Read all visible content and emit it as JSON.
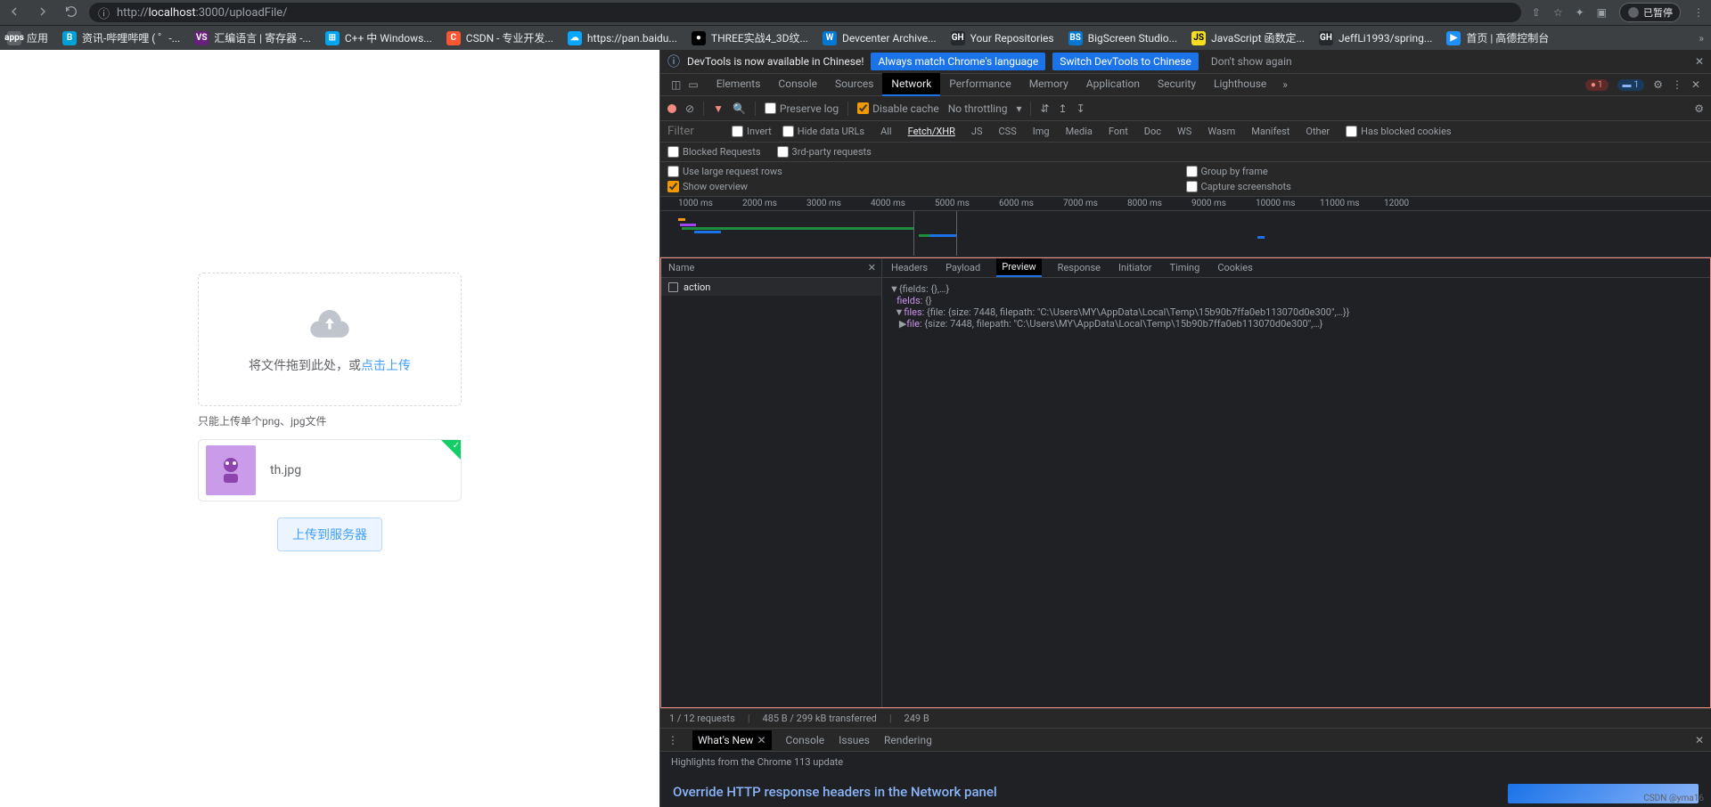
{
  "browser": {
    "url_prefix": "http://",
    "url_host": "localhost",
    "url_port": ":3000",
    "url_path": "/uploadFile/",
    "paused_label": "已暂停"
  },
  "bookmarks": [
    {
      "icon": "apps",
      "color": "#5f6368",
      "label": "应用"
    },
    {
      "icon": "B",
      "color": "#00a1d6",
      "label": "资讯-哔哩哔哩 ( ゜-..."
    },
    {
      "icon": "VS",
      "color": "#68217a",
      "label": "汇编语言 | 寄存器 -..."
    },
    {
      "icon": "⊞",
      "color": "#00a4ef",
      "label": "C++ 中 Windows..."
    },
    {
      "icon": "C",
      "color": "#fc5531",
      "label": "CSDN - 专业开发..."
    },
    {
      "icon": "☁",
      "color": "#06a7ff",
      "label": "https://pan.baidu..."
    },
    {
      "icon": "●",
      "color": "#000",
      "label": "THREE实战4_3D纹..."
    },
    {
      "icon": "W",
      "color": "#0078d4",
      "label": "Devcenter Archive..."
    },
    {
      "icon": "GH",
      "color": "#fff",
      "label": "Your Repositories"
    },
    {
      "icon": "BS",
      "color": "#0078d4",
      "label": "BigScreen Studio..."
    },
    {
      "icon": "JS",
      "color": "#f7df1e",
      "label": "JavaScript 函数定..."
    },
    {
      "icon": "GH",
      "color": "#fff",
      "label": "JeffLi1993/spring..."
    },
    {
      "icon": "▶",
      "color": "#1e90ff",
      "label": "首页 | 高德控制台"
    }
  ],
  "page": {
    "drag_text": "将文件拖到此处，或",
    "click_text": "点击上传",
    "tip": "只能上传单个png、jpg文件",
    "file_name": "th.jpg",
    "submit": "上传到服务器"
  },
  "devtools": {
    "banner_msg": "DevTools is now available in Chinese!",
    "banner_btn1": "Always match Chrome's language",
    "banner_btn2": "Switch DevTools to Chinese",
    "banner_dont": "Don't show again",
    "tabs": [
      "Elements",
      "Console",
      "Sources",
      "Network",
      "Performance",
      "Memory",
      "Application",
      "Security",
      "Lighthouse"
    ],
    "active_tab": "Network",
    "err_count": "1",
    "info_count": "1",
    "toolbar": {
      "preserve": "Preserve log",
      "disable_cache": "Disable cache",
      "throttling": "No throttling"
    },
    "filter": {
      "placeholder": "Filter",
      "invert": "Invert",
      "hide_data": "Hide data URLs",
      "types": [
        "All",
        "Fetch/XHR",
        "JS",
        "CSS",
        "Img",
        "Media",
        "Font",
        "Doc",
        "WS",
        "Wasm",
        "Manifest",
        "Other"
      ],
      "blocked_cookies": "Has blocked cookies",
      "blocked_req": "Blocked Requests",
      "third_party": "3rd-party requests"
    },
    "opts": {
      "large_rows": "Use large request rows",
      "show_overview": "Show overview",
      "group_frame": "Group by frame",
      "screenshots": "Capture screenshots"
    },
    "timeline_ticks": [
      "1000 ms",
      "2000 ms",
      "3000 ms",
      "4000 ms",
      "5000 ms",
      "6000 ms",
      "7000 ms",
      "8000 ms",
      "9000 ms",
      "10000 ms",
      "11000 ms",
      "12000"
    ],
    "req_list_header": "Name",
    "requests": [
      {
        "name": "action"
      }
    ],
    "detail_tabs": [
      "Headers",
      "Payload",
      "Preview",
      "Response",
      "Initiator",
      "Timing",
      "Cookies"
    ],
    "active_detail": "Preview",
    "preview": {
      "line1_pre": "{fields: {},…}",
      "line2": "fields",
      "line2v": "{}",
      "line3": "files",
      "line3v": "{file: {size: 7448, filepath: \"C:\\Users\\MY\\AppData\\Local\\Temp\\15b90b7ffa0eb113070d0e300\",…}}",
      "line4": "file",
      "line4v": "{size: 7448, filepath: \"C:\\Users\\MY\\AppData\\Local\\Temp\\15b90b7ffa0eb113070d0e300\",…}"
    },
    "status": {
      "requests": "1 / 12 requests",
      "transferred": "485 B / 299 kB transferred",
      "resources": "249 B"
    },
    "drawer_tabs": [
      "What's New",
      "Console",
      "Issues",
      "Rendering"
    ],
    "drawer_sub": "Highlights from the Chrome 113 update",
    "drawer_headline": "Override HTTP response headers in the Network panel",
    "watermark": "CSDN @yma16"
  }
}
